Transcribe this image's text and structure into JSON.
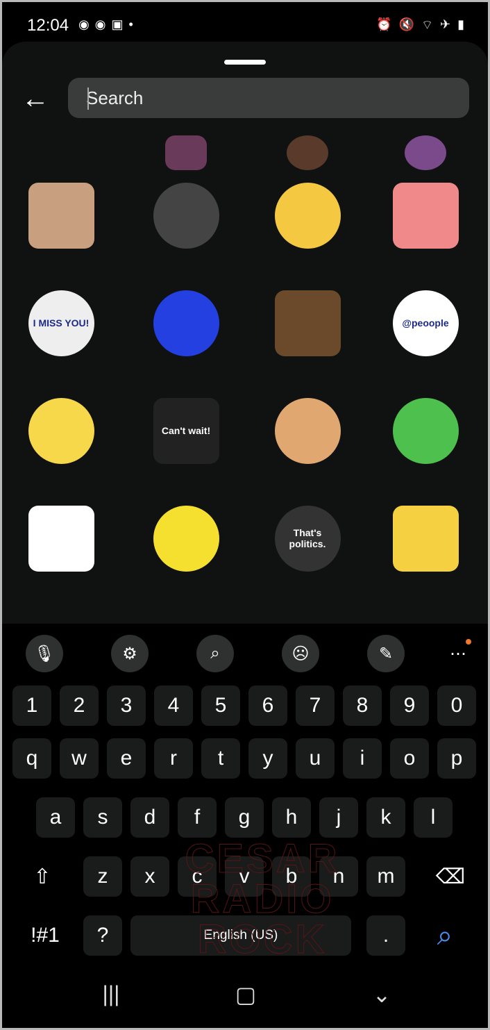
{
  "status_bar": {
    "time": "12:04",
    "left_icons": [
      "messenger-icon",
      "messenger-icon",
      "image-icon",
      "dot-icon"
    ],
    "right_icons": [
      "alarm-icon",
      "mute-icon",
      "wifi-icon",
      "airplane-icon",
      "battery-icon"
    ]
  },
  "search": {
    "placeholder": "Search",
    "value": ""
  },
  "stickers": [
    {
      "name": "sticker-partial-1"
    },
    {
      "name": "sticker-partial-2"
    },
    {
      "name": "sticker-partial-3"
    },
    {
      "name": "sticker-baby-thumbs-up"
    },
    {
      "name": "sticker-woman-phone"
    },
    {
      "name": "sticker-hug-emoji"
    },
    {
      "name": "sticker-heart-hands"
    },
    {
      "name": "sticker-i-miss-you",
      "text": "I MISS YOU!"
    },
    {
      "name": "sticker-blue-moon"
    },
    {
      "name": "sticker-man-desk"
    },
    {
      "name": "sticker-peoople",
      "text": "@peoople"
    },
    {
      "name": "sticker-homer"
    },
    {
      "name": "sticker-cant-wait",
      "text": "Can't wait!"
    },
    {
      "name": "sticker-thumbs-up"
    },
    {
      "name": "sticker-crying-dino"
    },
    {
      "name": "sticker-cat"
    },
    {
      "name": "sticker-heart-hands-red"
    },
    {
      "name": "sticker-politics",
      "text": "That's politics."
    },
    {
      "name": "sticker-koala-moon"
    }
  ],
  "keyboard": {
    "toolbar": [
      "microphone-icon",
      "settings-icon",
      "search-icon",
      "emoji-icon",
      "handwriting-icon",
      "more-icon"
    ],
    "numbers": [
      "1",
      "2",
      "3",
      "4",
      "5",
      "6",
      "7",
      "8",
      "9",
      "0"
    ],
    "row1": [
      "q",
      "w",
      "e",
      "r",
      "t",
      "y",
      "u",
      "i",
      "o",
      "p"
    ],
    "row2": [
      "a",
      "s",
      "d",
      "f",
      "g",
      "h",
      "j",
      "k",
      "l"
    ],
    "row3": [
      "z",
      "x",
      "c",
      "v",
      "b",
      "n",
      "m"
    ],
    "symbols_label": "!#1",
    "question": "?",
    "space_label": "English (US)",
    "period": ".",
    "accent": "#4a8ef0",
    "notification_dot": "#f07a2a"
  },
  "watermark": "Cesar Radio Rock"
}
